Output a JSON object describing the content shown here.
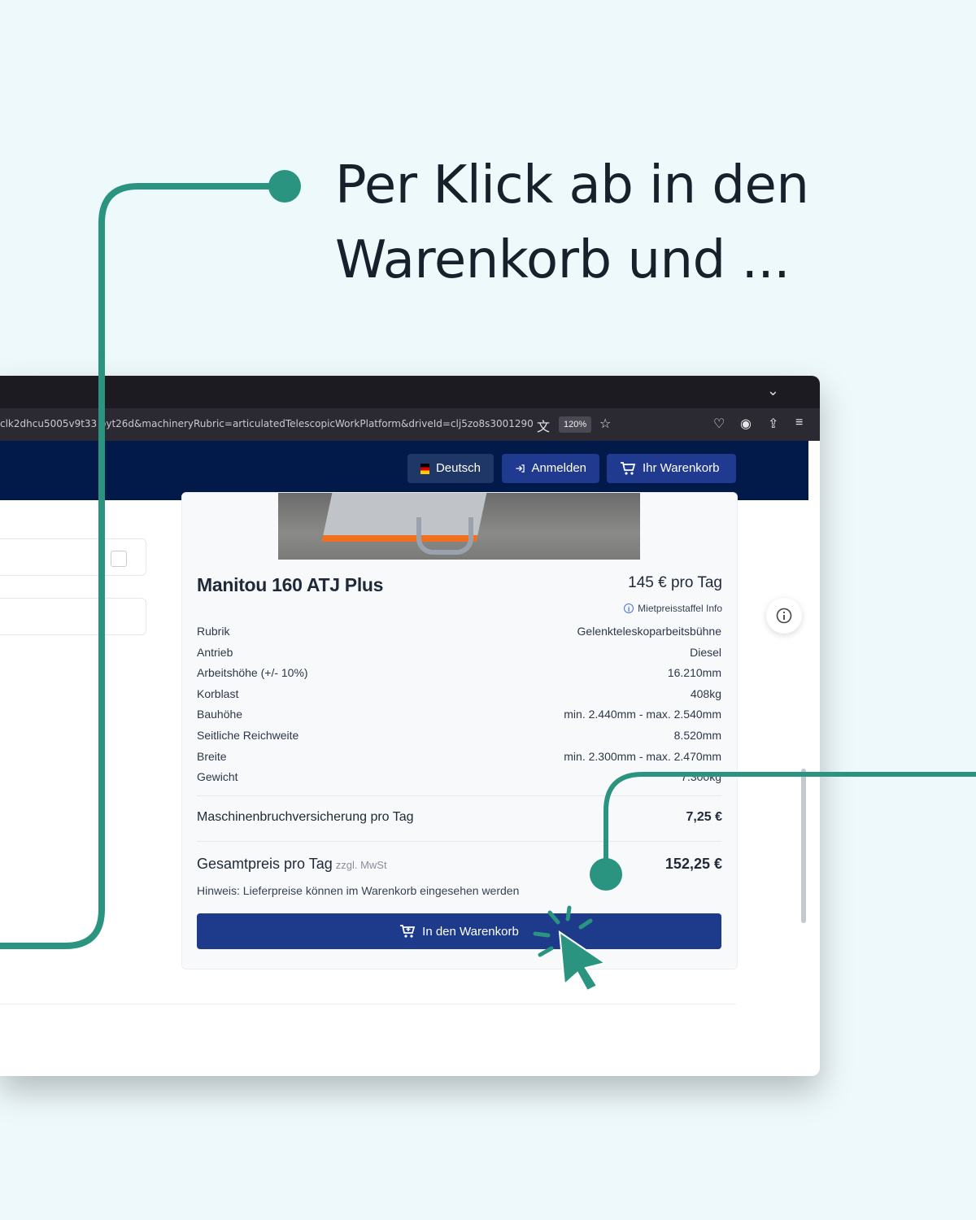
{
  "headline": {
    "line1": "Per Klick ab in den",
    "line2": "Warenkorb und ..."
  },
  "browser": {
    "url": "clk2dhcu5005v9t33  oyt26d&machineryRubric=articulatedTelescopicWorkPlatform&driveId=clj5zo8s3001290",
    "zoom": "120%"
  },
  "header": {
    "language_label": "Deutsch",
    "login_label": "Anmelden",
    "cart_label": "Ihr Warenkorb"
  },
  "product": {
    "title": "Manitou 160 ATJ Plus",
    "price": "145 € pro Tag",
    "price_info": "Mietpreisstaffel Info",
    "specs": [
      {
        "label": "Rubrik",
        "value": "Gelenkteleskoparbeitsbühne"
      },
      {
        "label": "Antrieb",
        "value": "Diesel"
      },
      {
        "label": "Arbeitshöhe (+/- 10%)",
        "value": "16.210mm"
      },
      {
        "label": "Korblast",
        "value": "408kg"
      },
      {
        "label": "Bauhöhe",
        "value": "min. 2.440mm - max. 2.540mm"
      },
      {
        "label": "Seitliche Reichweite",
        "value": "8.520mm"
      },
      {
        "label": "Breite",
        "value": "min. 2.300mm - max. 2.470mm"
      },
      {
        "label": "Gewicht",
        "value": "7.300kg"
      }
    ],
    "insurance_label": "Maschinenbruchversicherung pro Tag",
    "insurance_value": "7,25 €",
    "total_label": "Gesamtpreis pro Tag",
    "total_tax_note": "zzgl. MwSt",
    "total_value": "152,25 €",
    "delivery_note": "Hinweis: Lieferpreise können im Warenkorb eingesehen werden",
    "add_to_cart_label": "In den Warenkorb"
  },
  "colors": {
    "accent_green": "#2a9480",
    "header_navy": "#011a4a",
    "button_blue": "#1e3a8a"
  }
}
